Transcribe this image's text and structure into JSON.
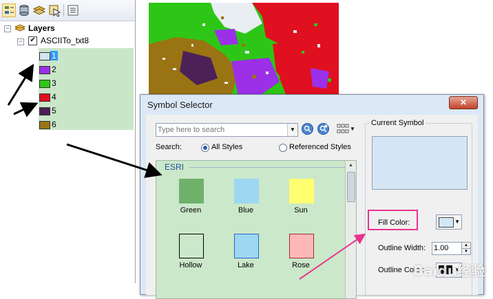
{
  "toc": {
    "toolbar_icons": [
      "list-by-drawing-order-icon",
      "list-by-source-icon",
      "list-by-visibility-icon",
      "list-by-selection-icon",
      "options-icon"
    ],
    "root_label": "Layers",
    "layer_name": "ASCIITo_txt8",
    "layer_checked": true,
    "legend": [
      {
        "label": "1",
        "color": "#d4e6f4",
        "selected": true
      },
      {
        "label": "2",
        "color": "#9b30e8",
        "selected": false
      },
      {
        "label": "3",
        "color": "#2ec616",
        "selected": false
      },
      {
        "label": "4",
        "color": "#e01020",
        "selected": false
      },
      {
        "label": "5",
        "color": "#4b2157",
        "selected": false
      },
      {
        "label": "6",
        "color": "#9a7412",
        "selected": false
      }
    ]
  },
  "dialog": {
    "title": "Symbol Selector",
    "close_glyph": "✕",
    "search_placeholder": "Type here to search",
    "search_label": "Search:",
    "radio_all": "All Styles",
    "radio_referenced": "Referenced Styles",
    "radio_selected": "all",
    "gallery_header": "ESRI",
    "symbols": [
      {
        "label": "Green",
        "fill": "#6fb06b",
        "stroke": "#6fb06b"
      },
      {
        "label": "Blue",
        "fill": "#9ed7f2",
        "stroke": "#9ed7f2"
      },
      {
        "label": "Sun",
        "fill": "#ffff70",
        "stroke": "#ffff70"
      },
      {
        "label": "Hollow",
        "fill": "#cbe8ca",
        "stroke": "#000000"
      },
      {
        "label": "Lake",
        "fill": "#9ed7f2",
        "stroke": "#2c64c8"
      },
      {
        "label": "Rose",
        "fill": "#ffb8b8",
        "stroke": "#a03030"
      }
    ],
    "current_symbol_title": "Current Symbol",
    "current_fill": "#d4e6f4",
    "fill_color_label": "Fill Color:",
    "outline_width_label": "Outline Width:",
    "outline_width_value": "1.00",
    "outline_color_label": "Outline Color:",
    "outline_color": "#111111"
  },
  "colors": {
    "map_purple": "#9b30e8",
    "map_green": "#2ec616",
    "map_red": "#e01020",
    "map_brown": "#9a7412",
    "map_dark": "#4b2157",
    "annotation_black": "#000000",
    "annotation_pink": "#e8348f"
  },
  "watermark": "Baidu经验"
}
